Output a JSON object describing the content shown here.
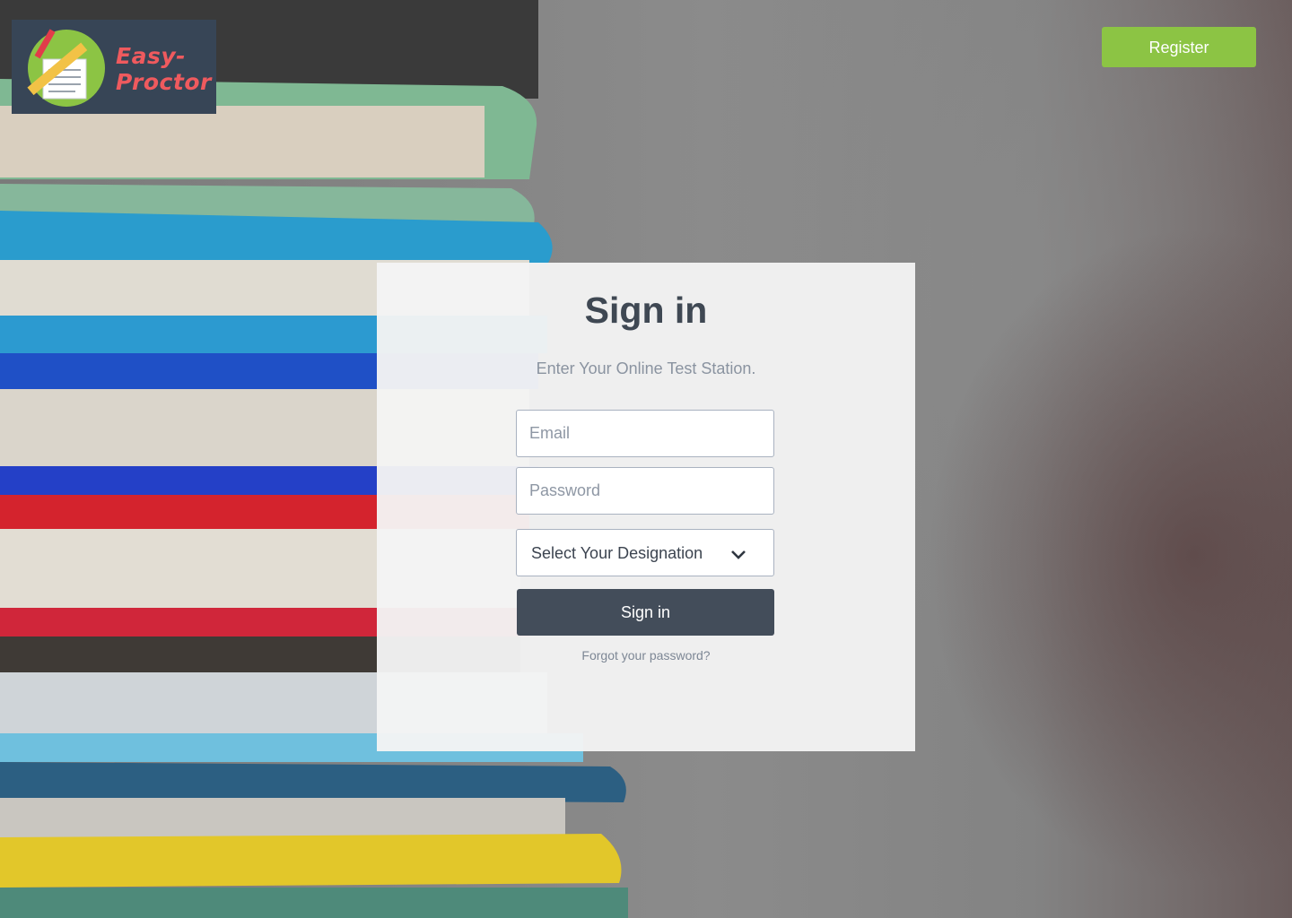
{
  "brand": {
    "name_line1": "Easy-",
    "name_line2": "Proctor",
    "logo_bg": "#374556",
    "logo_text_color": "#ef5a5e"
  },
  "header": {
    "register_label": "Register",
    "register_color": "#8cc444"
  },
  "signin": {
    "title": "Sign in",
    "subtitle": "Enter Your Online Test Station.",
    "email_placeholder": "Email",
    "password_placeholder": "Password",
    "designation_selected": "Select Your Designation",
    "submit_label": "Sign in",
    "submit_color": "#434d5a",
    "forgot_label": "Forgot your password?"
  }
}
